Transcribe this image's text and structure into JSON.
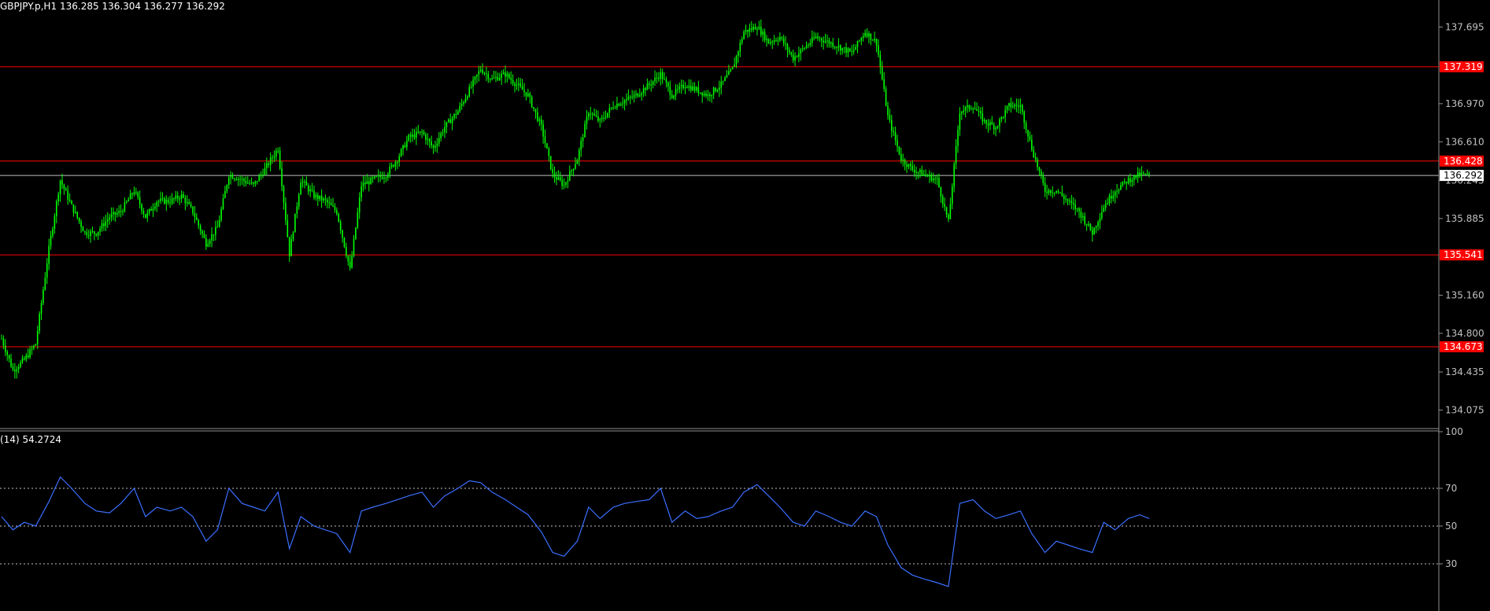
{
  "window": {
    "symbol_timeframe": "GBPJPY.p,H1",
    "ohlc_readout": "136.285 136.304 136.277 136.292",
    "rsi_label": "(14) 54.2724"
  },
  "colors": {
    "background": "#000000",
    "candle": "#00ff00",
    "level_line": "#ff0000",
    "level_tag": "#ff0000",
    "bid_line": "#c0c0c0",
    "rsi_line": "#3a6fff",
    "grid_text": "#c0c0c0"
  },
  "chart_data": [
    {
      "type": "candlestick",
      "symbol": "GBPJPY.p",
      "timeframe": "H1",
      "ylim": [
        133.9,
        137.95
      ],
      "price_axis_ticks": [
        "137.695",
        "136.970",
        "136.610",
        "136.245",
        "135.885",
        "135.160",
        "134.800",
        "134.435",
        "134.075"
      ],
      "price_axis_tick_values": [
        137.695,
        136.97,
        136.61,
        136.245,
        135.885,
        135.16,
        134.8,
        134.435,
        134.075
      ],
      "horizontal_levels": [
        {
          "label": "137.319",
          "value": 137.319
        },
        {
          "label": "136.428",
          "value": 136.428
        },
        {
          "label": "135.541",
          "value": 135.541
        },
        {
          "label": "134.673",
          "value": 134.673
        }
      ],
      "current_price": {
        "label": "136.292",
        "value": 136.292
      },
      "close_path": [
        [
          0,
          134.75
        ],
        [
          6,
          134.45
        ],
        [
          12,
          134.55
        ],
        [
          18,
          134.7
        ],
        [
          25,
          135.6
        ],
        [
          31,
          136.25
        ],
        [
          37,
          136.0
        ],
        [
          44,
          135.75
        ],
        [
          50,
          135.75
        ],
        [
          57,
          135.9
        ],
        [
          63,
          135.95
        ],
        [
          70,
          136.15
        ],
        [
          76,
          135.9
        ],
        [
          82,
          136.05
        ],
        [
          89,
          136.05
        ],
        [
          95,
          136.1
        ],
        [
          101,
          135.95
        ],
        [
          108,
          135.65
        ],
        [
          114,
          135.8
        ],
        [
          120,
          136.3
        ],
        [
          127,
          136.25
        ],
        [
          133,
          136.2
        ],
        [
          139,
          136.35
        ],
        [
          146,
          136.55
        ],
        [
          152,
          135.55
        ],
        [
          158,
          136.25
        ],
        [
          165,
          136.1
        ],
        [
          171,
          136.05
        ],
        [
          177,
          135.95
        ],
        [
          184,
          135.4
        ],
        [
          190,
          136.2
        ],
        [
          196,
          136.25
        ],
        [
          203,
          136.3
        ],
        [
          209,
          136.45
        ],
        [
          215,
          136.65
        ],
        [
          222,
          136.7
        ],
        [
          228,
          136.55
        ],
        [
          234,
          136.75
        ],
        [
          241,
          136.9
        ],
        [
          247,
          137.1
        ],
        [
          253,
          137.3
        ],
        [
          259,
          137.2
        ],
        [
          266,
          137.25
        ],
        [
          272,
          137.15
        ],
        [
          278,
          137.05
        ],
        [
          285,
          136.75
        ],
        [
          291,
          136.3
        ],
        [
          297,
          136.2
        ],
        [
          304,
          136.45
        ],
        [
          310,
          136.9
        ],
        [
          316,
          136.8
        ],
        [
          323,
          136.95
        ],
        [
          329,
          137.0
        ],
        [
          335,
          137.05
        ],
        [
          342,
          137.15
        ],
        [
          348,
          137.25
        ],
        [
          354,
          137.05
        ],
        [
          361,
          137.15
        ],
        [
          367,
          137.1
        ],
        [
          373,
          137.05
        ],
        [
          380,
          137.15
        ],
        [
          386,
          137.3
        ],
        [
          392,
          137.65
        ],
        [
          399,
          137.7
        ],
        [
          405,
          137.55
        ],
        [
          411,
          137.6
        ],
        [
          418,
          137.4
        ],
        [
          424,
          137.5
        ],
        [
          430,
          137.6
        ],
        [
          437,
          137.55
        ],
        [
          443,
          137.5
        ],
        [
          449,
          137.45
        ],
        [
          456,
          137.65
        ],
        [
          462,
          137.55
        ],
        [
          468,
          136.85
        ],
        [
          475,
          136.45
        ],
        [
          481,
          136.35
        ],
        [
          487,
          136.3
        ],
        [
          494,
          136.25
        ],
        [
          500,
          135.85
        ],
        [
          506,
          136.9
        ],
        [
          513,
          136.95
        ],
        [
          519,
          136.8
        ],
        [
          525,
          136.75
        ],
        [
          532,
          136.95
        ],
        [
          538,
          136.95
        ],
        [
          544,
          136.55
        ],
        [
          551,
          136.15
        ],
        [
          557,
          136.15
        ],
        [
          563,
          136.05
        ],
        [
          569,
          135.95
        ],
        [
          576,
          135.75
        ],
        [
          582,
          136.0
        ],
        [
          588,
          136.15
        ],
        [
          595,
          136.25
        ],
        [
          601,
          136.3
        ],
        [
          606,
          136.29
        ]
      ]
    },
    {
      "type": "line",
      "indicator": "RSI",
      "period": 14,
      "label": "(14) 54.2724",
      "last_value": 54.2724,
      "ylim": [
        5,
        100
      ],
      "axis_ticks": [
        "100",
        "70",
        "50",
        "30"
      ],
      "axis_tick_values": [
        100,
        70,
        50,
        30
      ],
      "levels": [
        70,
        50,
        30
      ],
      "x": [
        0,
        6,
        12,
        18,
        25,
        31,
        37,
        44,
        50,
        57,
        63,
        70,
        76,
        82,
        89,
        95,
        101,
        108,
        114,
        120,
        127,
        133,
        139,
        146,
        152,
        158,
        165,
        171,
        177,
        184,
        190,
        196,
        203,
        209,
        215,
        222,
        228,
        234,
        241,
        247,
        253,
        259,
        266,
        272,
        278,
        285,
        291,
        297,
        304,
        310,
        316,
        323,
        329,
        335,
        342,
        348,
        354,
        361,
        367,
        373,
        380,
        386,
        392,
        399,
        405,
        411,
        418,
        424,
        430,
        437,
        443,
        449,
        456,
        462,
        468,
        475,
        481,
        487,
        494,
        500,
        506,
        513,
        519,
        525,
        532,
        538,
        544,
        551,
        557,
        563,
        569,
        576,
        582,
        588,
        595,
        601,
        606
      ],
      "values": [
        55,
        48,
        52,
        50,
        63,
        76,
        70,
        62,
        58,
        57,
        62,
        70,
        55,
        60,
        58,
        60,
        55,
        42,
        48,
        70,
        62,
        60,
        58,
        68,
        38,
        55,
        50,
        48,
        46,
        36,
        58,
        60,
        62,
        64,
        66,
        68,
        60,
        66,
        70,
        74,
        73,
        68,
        64,
        60,
        56,
        47,
        36,
        34,
        42,
        60,
        54,
        60,
        62,
        63,
        64,
        70,
        52,
        58,
        54,
        55,
        58,
        60,
        68,
        72,
        66,
        60,
        52,
        50,
        58,
        55,
        52,
        50,
        58,
        55,
        40,
        28,
        24,
        22,
        20,
        18,
        62,
        64,
        58,
        54,
        56,
        58,
        46,
        36,
        42,
        40,
        38,
        36,
        52,
        48,
        54,
        56,
        54
      ]
    }
  ]
}
